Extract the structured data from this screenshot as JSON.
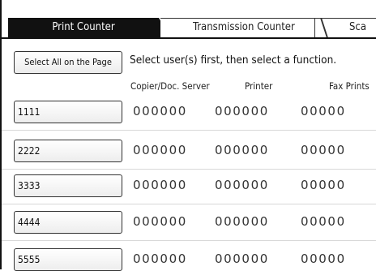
{
  "tabs": [
    {
      "label": "Print Counter",
      "active": true
    },
    {
      "label": "Transmission Counter",
      "active": false
    },
    {
      "label": "Sca",
      "active": false
    }
  ],
  "select_all_label": "Select All on the Page",
  "instruction": "Select user(s) first, then select a function.",
  "columns": [
    "Copier/Doc. Server",
    "Printer",
    "Fax Prints"
  ],
  "rows": [
    {
      "user": "1111",
      "counters": [
        "000000",
        "000000",
        "00000"
      ]
    },
    {
      "user": "2222",
      "counters": [
        "000000",
        "000000",
        "00000"
      ]
    },
    {
      "user": "3333",
      "counters": [
        "000000",
        "000000",
        "00000"
      ]
    },
    {
      "user": "4444",
      "counters": [
        "000000",
        "000000",
        "00000"
      ]
    },
    {
      "user": "5555",
      "counters": [
        "000000",
        "000000",
        "00000"
      ]
    }
  ],
  "colors": {
    "active_tab": "#111111",
    "border": "#333333"
  }
}
